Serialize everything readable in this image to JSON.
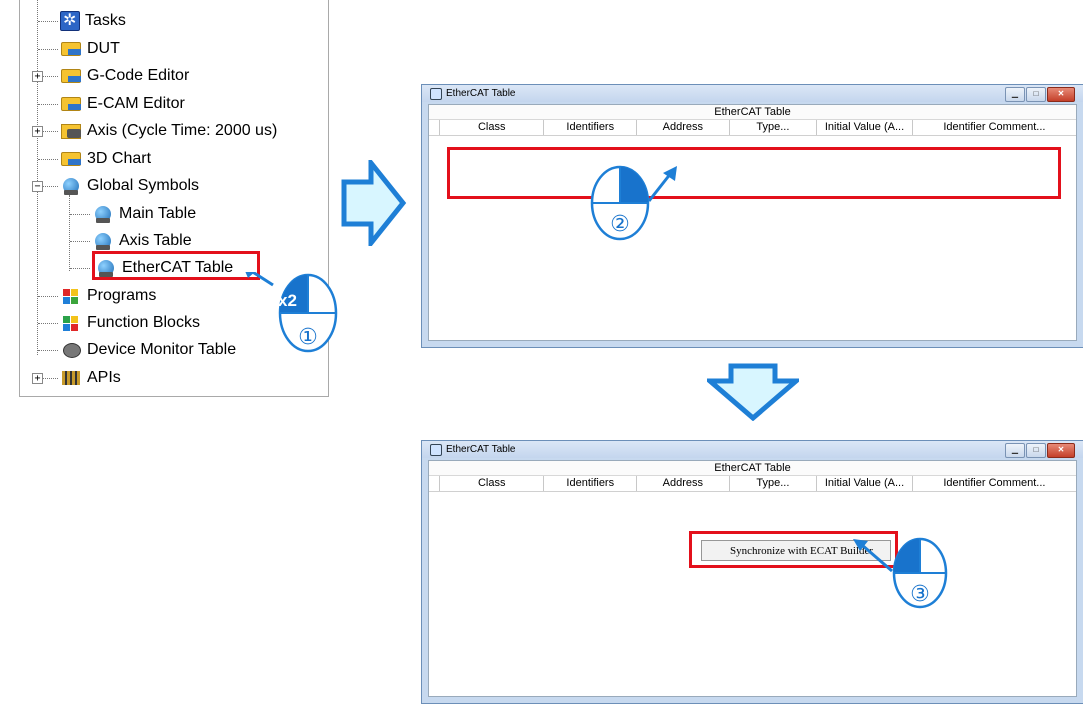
{
  "tree": {
    "items": [
      {
        "label": "Tasks",
        "icon": "gear-icon"
      },
      {
        "label": "DUT",
        "icon": "dut-folder-icon"
      },
      {
        "label": "G-Code Editor",
        "icon": "gcode-folder-icon"
      },
      {
        "label": "E-CAM Editor",
        "icon": "ecam-folder-icon"
      },
      {
        "label": "Axis (Cycle Time: 2000 us)",
        "icon": "axis-folder-icon"
      },
      {
        "label": "3D Chart",
        "icon": "chart-folder-icon"
      },
      {
        "label": "Global Symbols",
        "icon": "global-symbols-icon"
      },
      {
        "label": "Main Table",
        "icon": "table-globe-icon"
      },
      {
        "label": "Axis Table",
        "icon": "table-globe-icon"
      },
      {
        "label": "EtherCAT Table",
        "icon": "table-globe-icon"
      },
      {
        "label": "Programs",
        "icon": "programs-icon"
      },
      {
        "label": "Function Blocks",
        "icon": "function-blocks-icon"
      },
      {
        "label": "Device Monitor Table",
        "icon": "device-monitor-icon"
      },
      {
        "label": "APIs",
        "icon": "apis-icon"
      }
    ],
    "expander_plus": "+",
    "expander_minus": "−"
  },
  "steps": {
    "double_click_badge": "x2",
    "step1": "①",
    "step2": "②",
    "step3": "③"
  },
  "window1": {
    "title": "EtherCAT Table",
    "table_title": "EtherCAT Table",
    "columns": [
      "Class",
      "Identifiers",
      "Address",
      "Type...",
      "Initial Value (A...",
      "Identifier Comment..."
    ]
  },
  "window2": {
    "title": "EtherCAT Table",
    "table_title": "EtherCAT Table",
    "columns": [
      "Class",
      "Identifiers",
      "Address",
      "Type...",
      "Initial Value (A...",
      "Identifier Comment..."
    ],
    "context_menu_item": "Synchronize with ECAT Builder"
  },
  "colors": {
    "highlight": "#e3101b",
    "arrow_fill": "#d8f6ff",
    "arrow_stroke": "#1e7fd6",
    "mouse_blue": "#1873cc"
  }
}
